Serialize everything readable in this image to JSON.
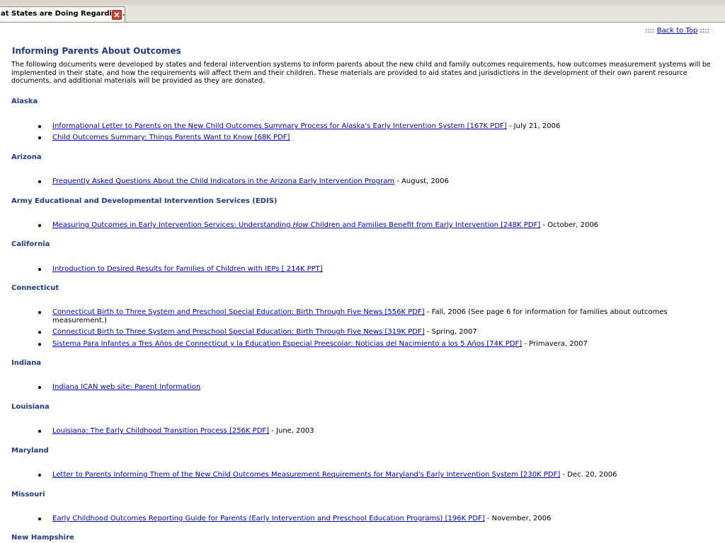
{
  "browser": {
    "tab_title": "at States are Doing Regardin..."
  },
  "page": {
    "back_to_top": {
      "prefix": ":::: ",
      "link": "Back to Top",
      "suffix": " ::::"
    },
    "title": "Informing Parents About Outcomes",
    "intro": "The following documents were developed by states and federal intervention systems to inform parents about the new child and family outcomes requirements, how outcomes measurement systems will be implemented in their state, and how the requirements will affect them and their children. These materials are provided to aid states and jurisdictions in the development of their own parent resource documents, and additional materials will be provided as they are donated."
  },
  "sections": [
    {
      "state": "Alaska",
      "docs": [
        {
          "link": "Informational Letter to Parents on the New Child Outcomes Summary Process for Alaska's Early Intervention System [167K PDF]",
          "trail": " - July 21, 2006"
        },
        {
          "link": "Child Outcomes Summary: Things Parents Want to Know [68K PDF]",
          "trail": ""
        }
      ]
    },
    {
      "state": "Arizona",
      "docs": [
        {
          "link": "Frequently Asked Questions About the Child Indicators in the Arizona Early Intervention Program",
          "trail": " - August, 2006"
        }
      ]
    },
    {
      "state": "Army Educational and Developmental Intervention Services (EDIS)",
      "docs": [
        {
          "link_parts": [
            "Measuring Outcomes in Early Intervention Services: Understanding ",
            "How",
            " Children and Families Benefit from Early Intervention [248K PDF]"
          ],
          "trail": " - October, 2006"
        }
      ]
    },
    {
      "state": "California",
      "docs": [
        {
          "link": "Introduction to Desired Results for Families of Children with IEPs [ 214K PPT]",
          "trail": ""
        }
      ]
    },
    {
      "state": "Connecticut",
      "docs": [
        {
          "link": "Connecticut Birth to Three System and Preschool Special Education: Birth Through Five News [556K PDF]",
          "trail": " - Fall, 2006 (See page 6 for information for families about outcomes measurement.)"
        },
        {
          "link": "Connecticut Birth to Three System and Preschool Special Education: Birth Through Five News [319K PDF]",
          "trail": " - Spring, 2007"
        },
        {
          "link": "Sistema Para Infantes a Tres Años de Connecticut y la Education Especial Preescolar: Noticias del Nacimiento a los 5 Años [74K PDF]",
          "trail": " - Primavera, 2007"
        }
      ]
    },
    {
      "state": "Indiana",
      "docs": [
        {
          "link": "Indiana ICAN web site: Parent Information",
          "trail": ""
        }
      ]
    },
    {
      "state": "Louisiana",
      "docs": [
        {
          "link": "Louisiana: The Early Childhood Transition Process [256K PDF]",
          "trail": " - June, 2003"
        }
      ]
    },
    {
      "state": "Maryland",
      "docs": [
        {
          "link": "Letter to Parents Informing Them of the New Child Outcomes Measurement Requirements for Maryland's Early Intervention System [230K PDF]",
          "trail": " - Dec. 20, 2006"
        }
      ]
    },
    {
      "state": "Missouri",
      "docs": [
        {
          "link": "Early Childhood Outcomes Reporting Guide for Parents (Early Intervention and Preschool Education Programs) [196K PDF]",
          "trail": " - November, 2006"
        }
      ]
    },
    {
      "state": "New Hampshire",
      "docs": []
    }
  ]
}
